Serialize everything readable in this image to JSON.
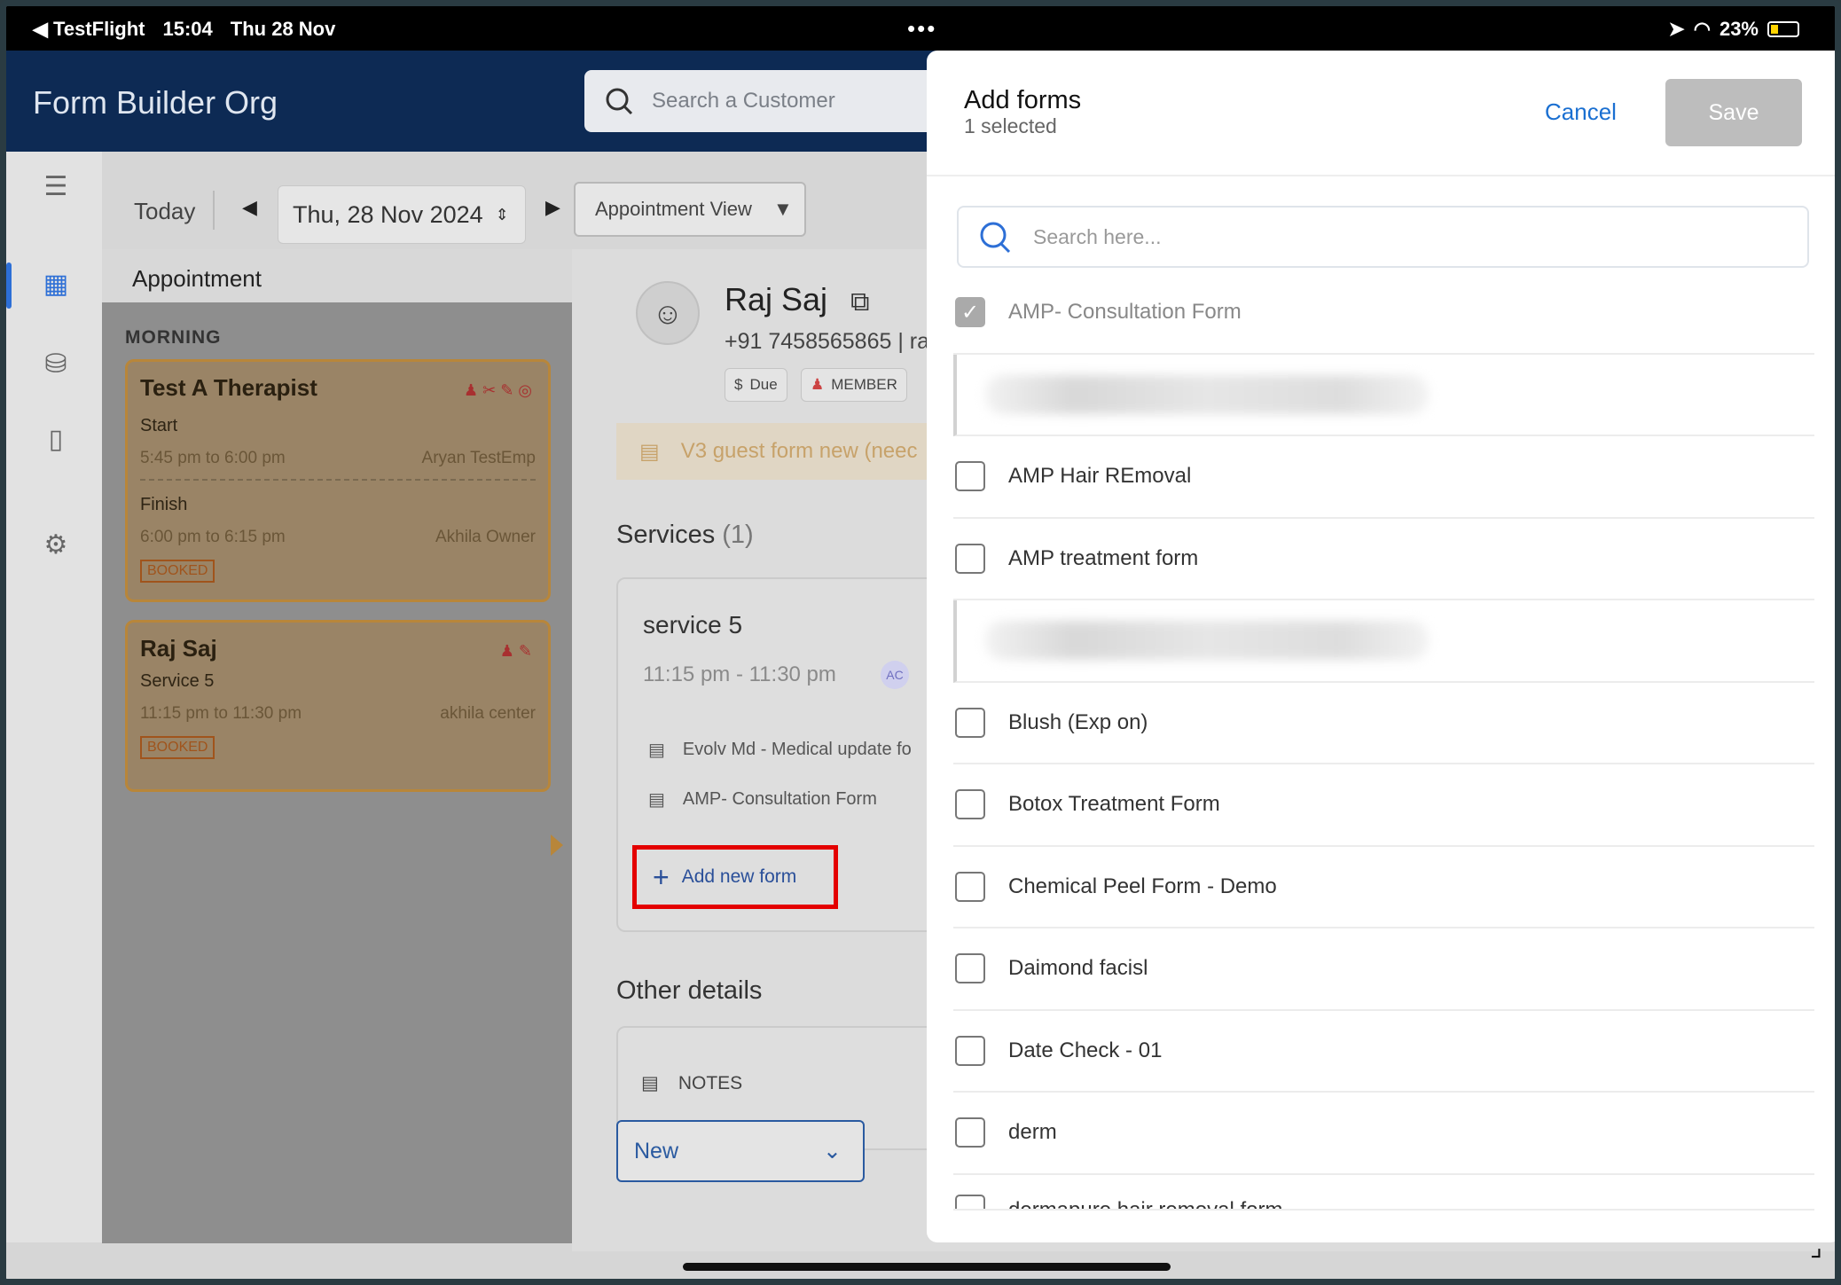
{
  "status_bar": {
    "back_app": "◀ TestFlight",
    "time": "15:04",
    "date": "Thu 28 Nov",
    "dots": "•••",
    "battery": "23%"
  },
  "app": {
    "org_name": "Form Builder Org",
    "search_placeholder": "Search a Customer"
  },
  "toolbar": {
    "today": "Today",
    "date": "Thu, 28 Nov 2024",
    "view": "Appointment View"
  },
  "appointments": {
    "header": "Appointment",
    "section": "MORNING",
    "cards": [
      {
        "name": "Test A Therapist",
        "start_label": "Start",
        "start_time": "5:45 pm to 6:00 pm",
        "start_staff": "Aryan TestEmp",
        "finish_label": "Finish",
        "finish_time": "6:00 pm to 6:15 pm",
        "finish_staff": "Akhila Owner",
        "badge": "BOOKED"
      },
      {
        "name": "Raj Saj",
        "service": "Service 5",
        "time": "11:15 pm to 11:30 pm",
        "staff": "akhila center",
        "badge": "BOOKED"
      }
    ]
  },
  "detail": {
    "customer_name": "Raj Saj",
    "phone": "+91 7458565865 | ra",
    "tags": [
      "Due",
      "MEMBER"
    ],
    "guest_form": "V3 guest form new (neec",
    "services_label": "Services",
    "services_count": "(1)",
    "service_name": "service 5",
    "service_time": "11:15 pm - 11:30 pm",
    "service_staff_initials": "AC",
    "forms": [
      "Evolv Md - Medical update fo",
      "AMP- Consultation Form"
    ],
    "add_form": "Add new form",
    "other_details": "Other details",
    "notes": "NOTES",
    "status": "New"
  },
  "modal": {
    "title": "Add forms",
    "subtitle": "1 selected",
    "cancel": "Cancel",
    "save": "Save",
    "search_placeholder": "Search here...",
    "items": [
      {
        "label": "AMP- Consultation Form",
        "checked": true
      },
      {
        "label": "",
        "blurred": true
      },
      {
        "label": "AMP Hair REmoval",
        "checked": false
      },
      {
        "label": "AMP treatment form",
        "checked": false
      },
      {
        "label": "",
        "blurred": true
      },
      {
        "label": "Blush (Exp on)",
        "checked": false
      },
      {
        "label": "Botox Treatment Form",
        "checked": false
      },
      {
        "label": "Chemical Peel Form - Demo",
        "checked": false
      },
      {
        "label": "Daimond facisl",
        "checked": false
      },
      {
        "label": "Date Check - 01",
        "checked": false
      },
      {
        "label": "derm",
        "checked": false
      },
      {
        "label": "dermapure hair removal form",
        "checked": false
      }
    ]
  }
}
